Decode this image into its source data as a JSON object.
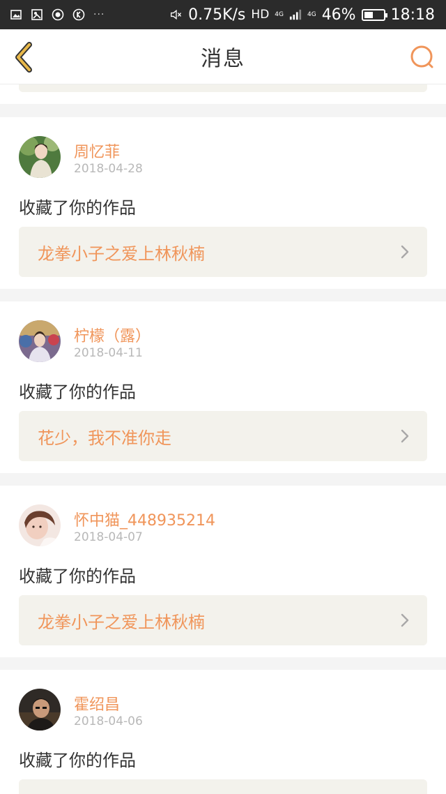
{
  "status_bar": {
    "speed": "0.75K/s",
    "hd": "HD",
    "net": "4G",
    "net2": "4G",
    "battery": "46%",
    "battery_level": 0.46,
    "time": "18:18",
    "overflow": "···"
  },
  "header": {
    "title": "消息",
    "back_icon": "chevron-left-icon",
    "search_icon": "search-icon"
  },
  "colors": {
    "accent": "#f0955a",
    "back_accent": "#e8b84a",
    "box_bg": "#f3f2ec"
  },
  "messages": [
    {
      "name": "周忆菲",
      "date": "2018-04-28",
      "action": "收藏了你的作品",
      "work": "龙拳小子之爱上林秋楠"
    },
    {
      "name": "柠檬（露）",
      "date": "2018-04-11",
      "action": "收藏了你的作品",
      "work": "花少，我不准你走"
    },
    {
      "name": "怀中猫_448935214",
      "date": "2018-04-07",
      "action": "收藏了你的作品",
      "work": "龙拳小子之爱上林秋楠"
    },
    {
      "name": "霍绍昌",
      "date": "2018-04-06",
      "action": "收藏了你的作品"
    }
  ]
}
